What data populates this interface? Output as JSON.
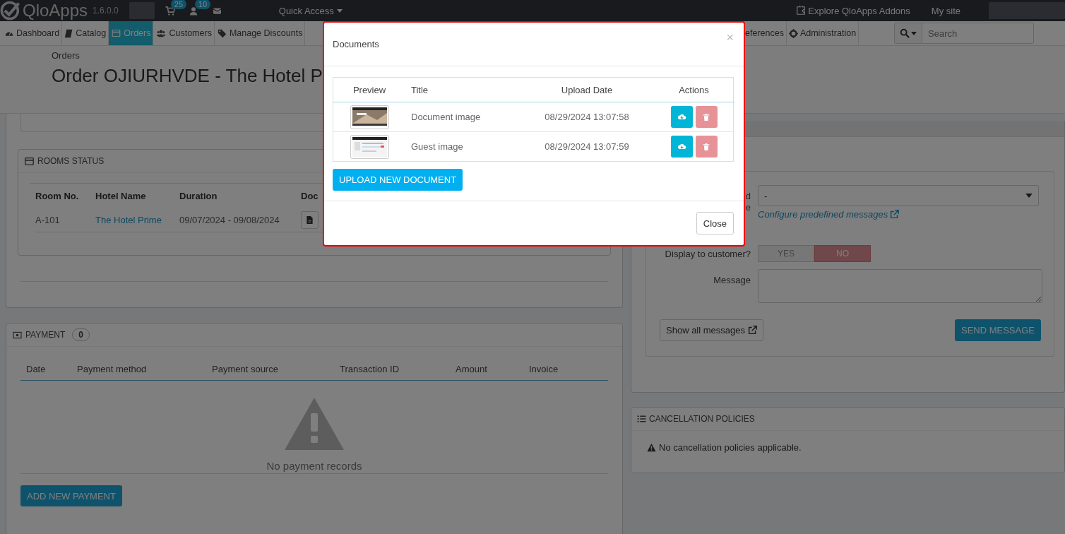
{
  "topbar": {
    "logo": "QloApps",
    "version": "1.6.0.0",
    "badges": [
      {
        "kind": "cart",
        "count": "25"
      },
      {
        "kind": "user",
        "count": "10"
      },
      {
        "kind": "mail"
      }
    ],
    "quick_access": "Quick Access",
    "explore": "Explore QloApps Addons",
    "my_site": "My site"
  },
  "nav": {
    "items": [
      {
        "label": "Dashboard",
        "kind": "dashboard",
        "selected": false
      },
      {
        "label": "Catalog",
        "kind": "book",
        "selected": false
      },
      {
        "label": "Orders",
        "kind": "card",
        "selected": true
      },
      {
        "label": "Customers",
        "kind": "users",
        "selected": false
      },
      {
        "label": "Manage Discounts",
        "kind": "tags",
        "selected": false
      }
    ],
    "items_right": [
      {
        "label": "eferences",
        "kind": "none",
        "selected": false
      },
      {
        "label": "Administration",
        "kind": "gear",
        "selected": false
      }
    ],
    "search_placeholder": "Search"
  },
  "header": {
    "breadcrumb": "Orders",
    "title": "Order OJIURHVDE - The Hotel P"
  },
  "rooms_status": {
    "title": "ROOMS STATUS",
    "columns": [
      "Room No.",
      "Hotel Name",
      "Duration",
      "Doc"
    ],
    "rows": [
      {
        "room": "A-101",
        "hotel": "The Hotel Prime",
        "duration": "09/07/2024 - 09/08/2024"
      }
    ]
  },
  "payment": {
    "title": "PAYMENT",
    "count": "0",
    "columns": [
      "Date",
      "Payment method",
      "Payment source",
      "Transaction ID",
      "Amount",
      "Invoice"
    ],
    "empty": "No payment records",
    "add_button": "ADD NEW PAYMENT"
  },
  "messages": {
    "label_fragments": [
      "d",
      "e"
    ],
    "select_value": "-",
    "configure_link": "Configure predefined messages",
    "display_label": "Display to customer?",
    "toggle": [
      {
        "label": "YES",
        "selected": false
      },
      {
        "label": "NO",
        "selected": true
      }
    ],
    "message_label": "Message",
    "show_all": "Show all messages",
    "send": "SEND MESSAGE"
  },
  "cancellation": {
    "title": "CANCELLATION POLICIES",
    "note": "No cancellation policies applicable."
  },
  "modal": {
    "title": "Documents",
    "close_icon": "×",
    "columns": [
      "Preview",
      "Title",
      "Upload Date",
      "Actions"
    ],
    "rows": [
      {
        "title": "Document image",
        "date": "08/29/2024 13:07:58"
      },
      {
        "title": "Guest image",
        "date": "08/29/2024 13:07:59"
      }
    ],
    "upload_button": "UPLOAD NEW DOCUMENT",
    "close_button": "Close"
  }
}
